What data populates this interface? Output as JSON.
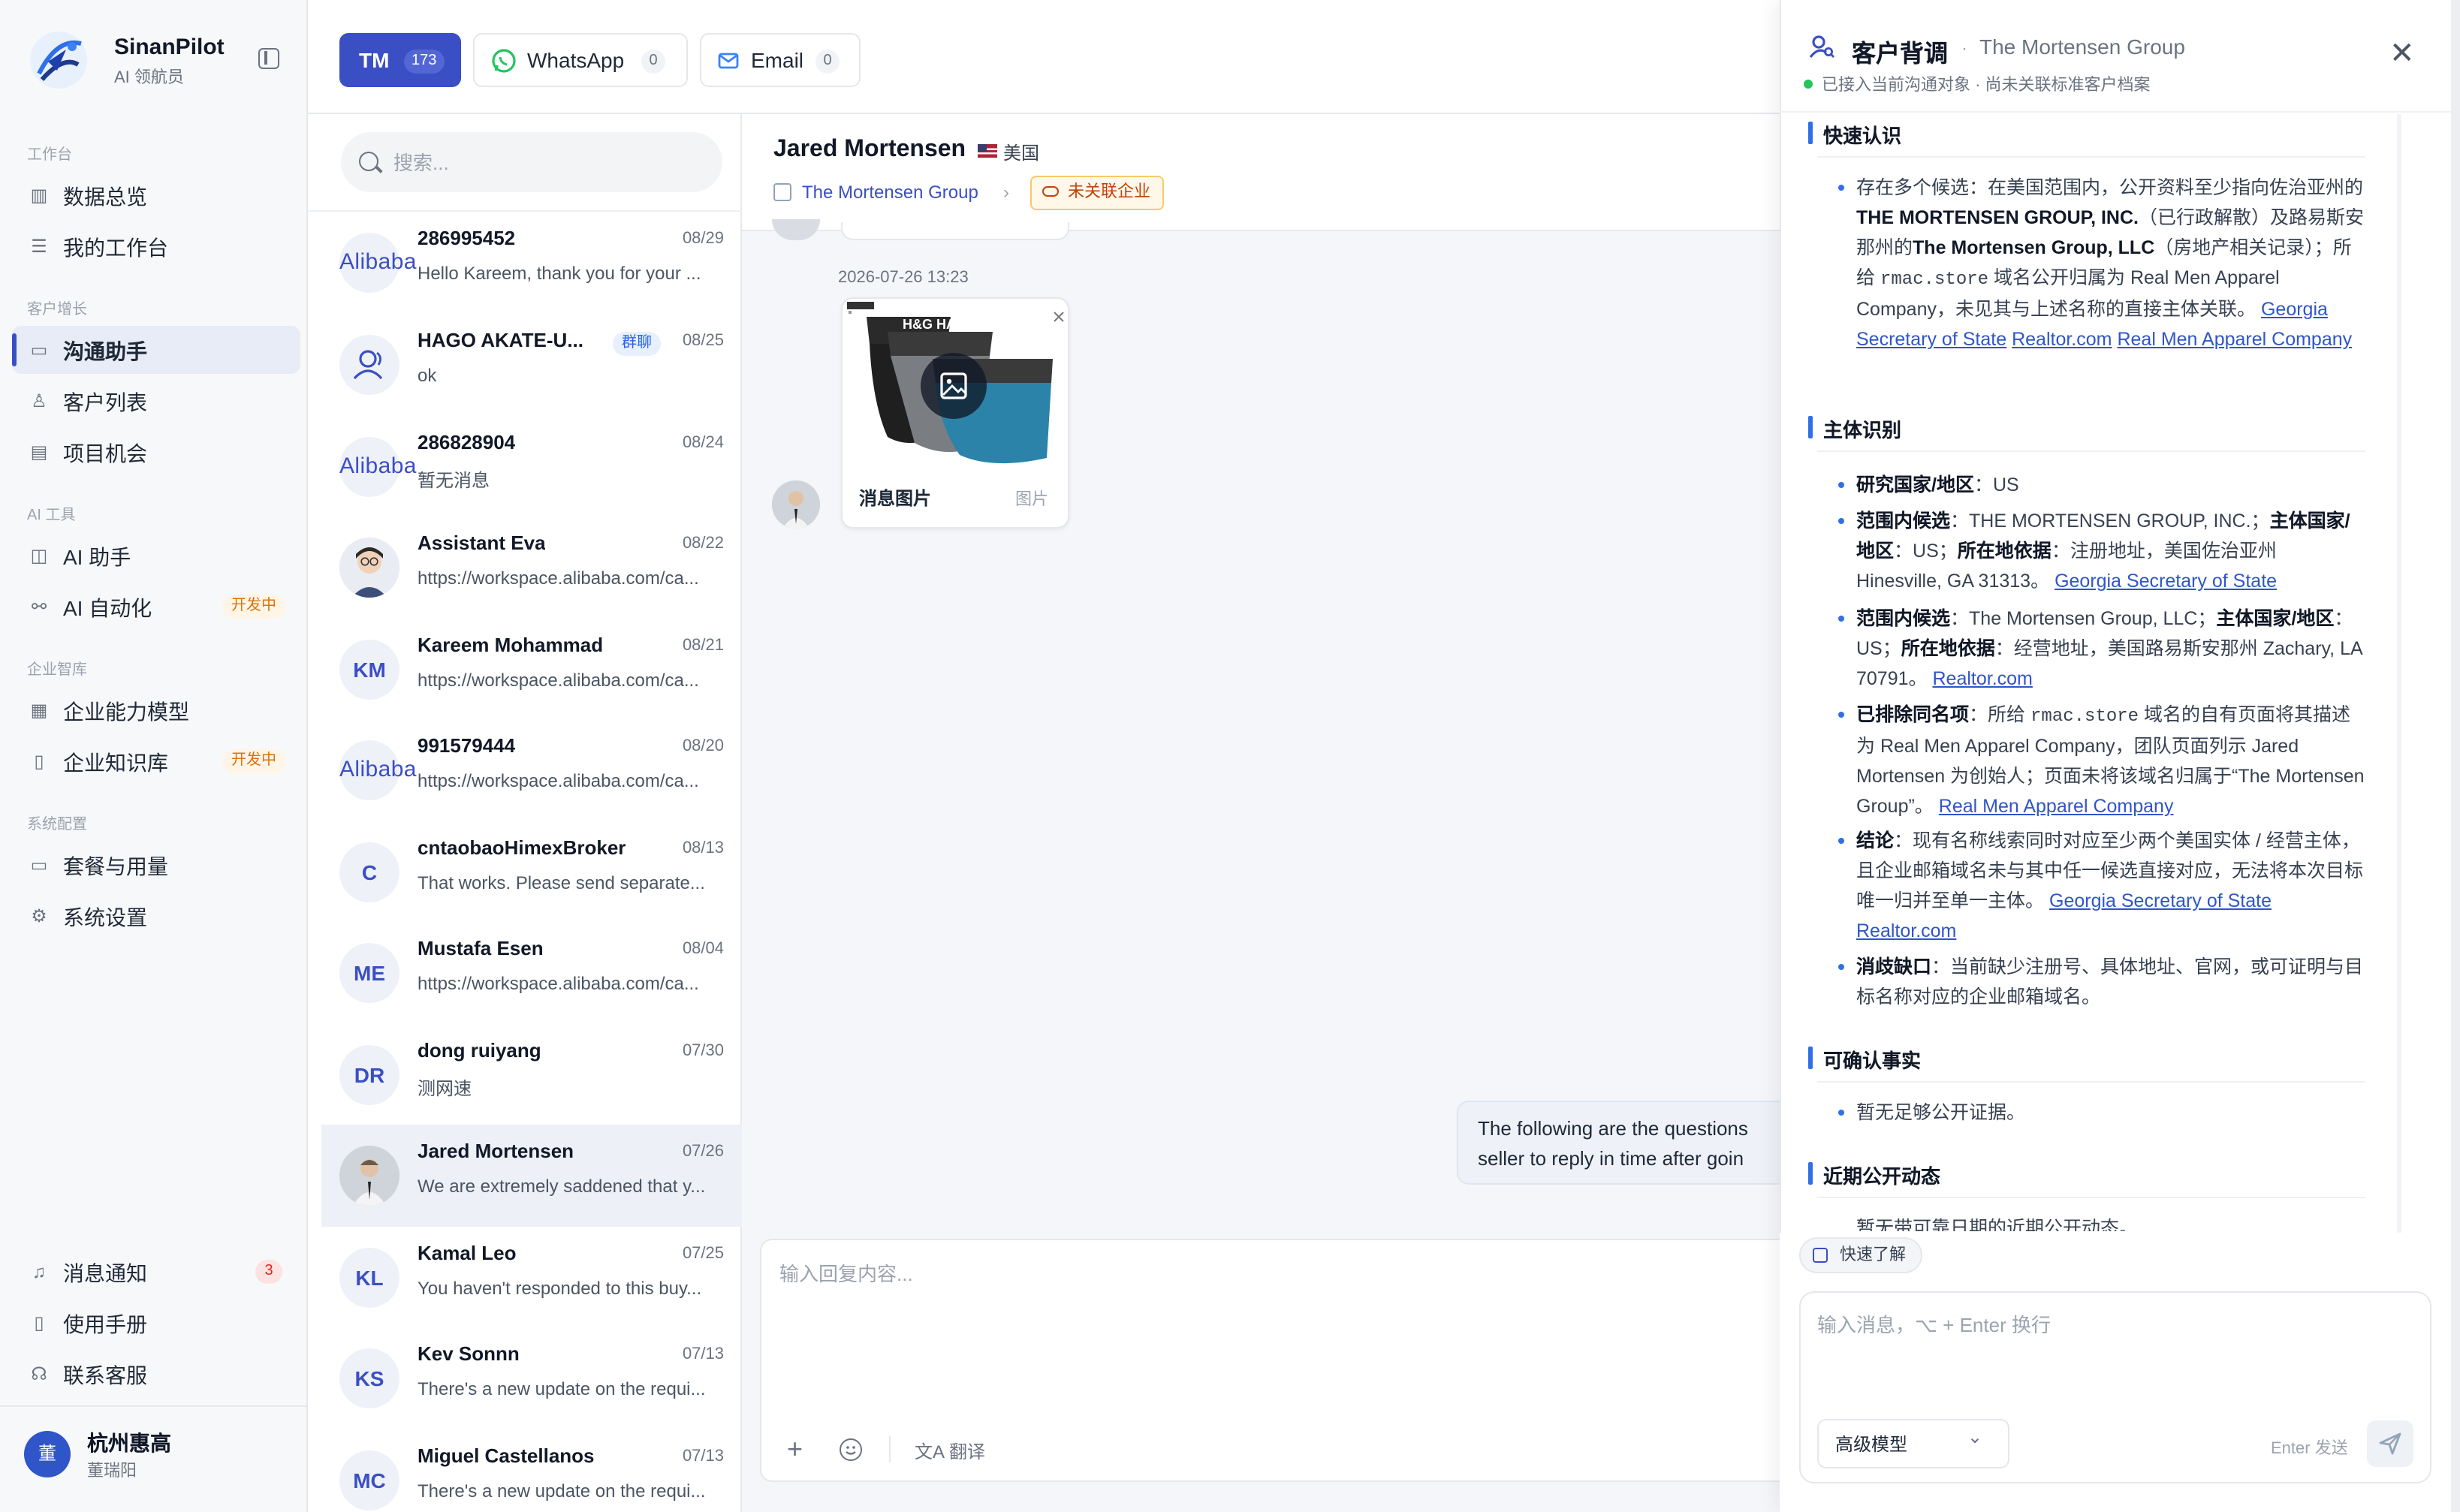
{
  "sidebar": {
    "brand": "SinanPilot",
    "brand_sub": "AI 领航员",
    "sections": [
      {
        "label": "工作台",
        "items": [
          {
            "label": "数据总览",
            "icon": "bar-chart-icon"
          },
          {
            "label": "我的工作台",
            "icon": "list-check-icon"
          }
        ]
      },
      {
        "label": "客户增长",
        "items": [
          {
            "label": "沟通助手",
            "icon": "chat-icon",
            "active": true
          },
          {
            "label": "客户列表",
            "icon": "users-icon"
          },
          {
            "label": "项目机会",
            "icon": "briefcase-icon"
          }
        ]
      },
      {
        "label": "AI 工具",
        "items": [
          {
            "label": "AI 助手",
            "icon": "robot-icon"
          },
          {
            "label": "AI 自动化",
            "icon": "flow-icon",
            "badge": "开发中"
          }
        ]
      },
      {
        "label": "企业智库",
        "items": [
          {
            "label": "企业能力模型",
            "icon": "building-icon"
          },
          {
            "label": "企业知识库",
            "icon": "book-icon",
            "badge": "开发中"
          }
        ]
      },
      {
        "label": "系统配置",
        "items": [
          {
            "label": "套餐与用量",
            "icon": "card-icon"
          },
          {
            "label": "系统设置",
            "icon": "gear-icon"
          }
        ]
      }
    ],
    "bottom": [
      {
        "label": "消息通知",
        "icon": "bell-icon",
        "count": "3"
      },
      {
        "label": "使用手册",
        "icon": "book-icon"
      },
      {
        "label": "联系客服",
        "icon": "headset-icon"
      }
    ],
    "user": {
      "avatar": "董",
      "name": "杭州惠高",
      "sub": "董瑞阳"
    }
  },
  "channels": [
    {
      "label": "TM",
      "count": "173"
    },
    {
      "label": "WhatsApp",
      "count": "0"
    },
    {
      "label": "Email",
      "count": "0"
    }
  ],
  "search": {
    "placeholder": "搜索..."
  },
  "conversations": [
    {
      "avatar": "Alibaba",
      "name": "286995452",
      "date": "08/29",
      "preview": "Hello Kareem, thank you for your ..."
    },
    {
      "avatar": "group-icon",
      "name": "HAGO AKATE-U...",
      "tag": "群聊",
      "date": "08/25",
      "preview": "ok"
    },
    {
      "avatar": "Alibaba",
      "name": "286828904",
      "date": "08/24",
      "preview": "暂无消息"
    },
    {
      "avatar": "photo",
      "name": "Assistant Eva",
      "date": "08/22",
      "preview": "https://workspace.alibaba.com/ca..."
    },
    {
      "avatar": "KM",
      "name": "Kareem Mohammad",
      "date": "08/21",
      "preview": "https://workspace.alibaba.com/ca..."
    },
    {
      "avatar": "Alibaba",
      "name": "991579444",
      "date": "08/20",
      "preview": "https://workspace.alibaba.com/ca..."
    },
    {
      "avatar": "C",
      "name": "cntaobaoHimexBroker",
      "date": "08/13",
      "preview": "That works. Please send separate..."
    },
    {
      "avatar": "ME",
      "name": "Mustafa Esen",
      "date": "08/04",
      "preview": "https://workspace.alibaba.com/ca..."
    },
    {
      "avatar": "DR",
      "name": "dong ruiyang",
      "date": "07/30",
      "preview": "测网速"
    },
    {
      "avatar": "photo",
      "name": "Jared Mortensen",
      "date": "07/26",
      "preview": "We are extremely saddened that y...",
      "selected": true
    },
    {
      "avatar": "KL",
      "name": "Kamal Leo",
      "date": "07/25",
      "preview": "You haven't responded to this buy..."
    },
    {
      "avatar": "KS",
      "name": "Kev Sonnn",
      "date": "07/13",
      "preview": "There's a new update on the requi..."
    },
    {
      "avatar": "MC",
      "name": "Miguel Castellanos",
      "date": "07/13",
      "preview": "There's a new update on the requi..."
    }
  ],
  "chat": {
    "contact_name": "Jared Mortensen",
    "country": "美国",
    "company": "The Mortensen Group",
    "unlinked_badge": "未关联企业",
    "timestamp": "2026-07-26 13:23",
    "image_caption": "消息图片",
    "image_type": "图片",
    "image_brand": "H&G HAGO",
    "outgoing_line1": "The following are the questions",
    "outgoing_line2": "seller to reply in time after goin",
    "composer_placeholder": "输入回复内容...",
    "translate_label": "翻译"
  },
  "panel": {
    "title": "客户背调",
    "company": "The Mortensen Group",
    "status": "已接入当前沟通对象 · 尚未关联标准客户档案",
    "sections": {
      "quick": "快速认识",
      "entity": "主体识别",
      "facts": "可确认事实",
      "news": "近期公开动态"
    },
    "quick_a": "存在多个候选：在美国范围内，公开资料至少指向佐治亚州的",
    "quick_b": "THE MORTENSEN GROUP, INC.",
    "quick_c": "（已行政解散）及路易斯安那州的",
    "quick_d": "The Mortensen Group, LLC",
    "quick_e": "（房地产相关记录）；所给",
    "quick_f": "rmac.store",
    "quick_g": "域名公开归属为 Real Men Apparel Company，未见其与上述名称的直接主体关联。",
    "quick_links": [
      "Georgia Secretary of State",
      "Realtor.com",
      "Real Men Apparel Company"
    ],
    "e1_k": "研究国家/地区",
    "e1_v": "：US",
    "e2_k1": "范围内候选",
    "e2_v1": "：THE MORTENSEN GROUP, INC.；",
    "e2_k2": "主体国家/地区",
    "e2_v2": "：US；",
    "e2_k3": "所在地依据",
    "e2_v3": "：注册地址，美国佐治亚州 Hinesville, GA 31313。",
    "e2_link": "Georgia Secretary of State",
    "e3_k1": "范围内候选",
    "e3_v1": "：The Mortensen Group, LLC；",
    "e3_k2": "主体国家/地区",
    "e3_v2": "：US；",
    "e3_k3": "所在地依据",
    "e3_v3": "：经营地址，美国路易斯安那州 Zachary, LA 70791。",
    "e3_link": "Realtor.com",
    "e4_k": "已排除同名项",
    "e4_v1": "：所给",
    "e4_code": "rmac.store",
    "e4_v2": "域名的自有页面将其描述为 Real Men Apparel Company，团队页面列示 Jared Mortensen 为创始人；页面未将该域名归属于“The Mortensen Group”。",
    "e4_link": "Real Men Apparel Company",
    "e5_k": "结论",
    "e5_v": "：现有名称线索同时对应至少两个美国实体 / 经营主体，且企业邮箱域名未与其中任一候选直接对应，无法将本次目标唯一归并至单一主体。",
    "e5_link1": "Georgia Secretary of State",
    "e5_link2": "Realtor.com",
    "e6_k": "消歧缺口",
    "e6_v": "：当前缺少注册号、具体地址、官网，或可证明与目标名称对应的企业邮箱域名。",
    "facts_1": "暂无足够公开证据。",
    "news_1": "暂无带可靠日期的近期公开动态。",
    "quick_chip": "快速了解",
    "ai_placeholder": "输入消息，⌥ + Enter 换行",
    "model": "高级模型",
    "enter_hint": "Enter 发送"
  }
}
